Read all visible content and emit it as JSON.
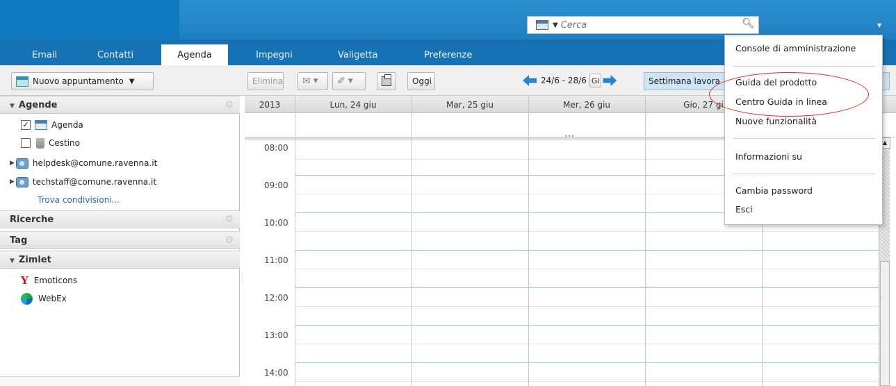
{
  "search": {
    "placeholder": "Cerca"
  },
  "app_tabs": {
    "email": "Email",
    "contacts": "Contatti",
    "calendar": "Agenda",
    "tasks": "Impegni",
    "briefcase": "Valigetta",
    "preferences": "Preferenze"
  },
  "toolbar": {
    "new_appointment": "Nuovo appuntamento",
    "delete": "Elimina",
    "today": "Oggi",
    "date_range": "24/6 - 28/6",
    "day_view": "Gi",
    "work_week": "Settimana lavora"
  },
  "sidebar": {
    "calendars_header": "Agende",
    "calendar_item": "Agenda",
    "trash_item": "Cestino",
    "share_1": "helpdesk@comune.ravenna.it",
    "share_2": "techstaff@comune.ravenna.it",
    "find_shares": "Trova condivisioni...",
    "searches_header": "Ricerche",
    "tags_header": "Tag",
    "zimlet_header": "Zimlet",
    "zimlet_1": "Emoticons",
    "zimlet_2": "WebEx"
  },
  "calendar": {
    "year": "2013",
    "days": [
      "Lun, 24 giu",
      "Mar, 25 giu",
      "Mer, 26 giu",
      "Gio, 27 gi"
    ],
    "hours": [
      "08:00",
      "09:00",
      "10:00",
      "11:00",
      "12:00",
      "13:00",
      "14:00"
    ]
  },
  "help_menu": {
    "admin_console": "Console di amministrazione",
    "product_help": "Guida del prodotto",
    "online_help": "Centro Guida in linea",
    "new_features": "Nuove funzionalità",
    "about": "Informazioni su",
    "change_password": "Cambia password",
    "logout": "Esci"
  }
}
